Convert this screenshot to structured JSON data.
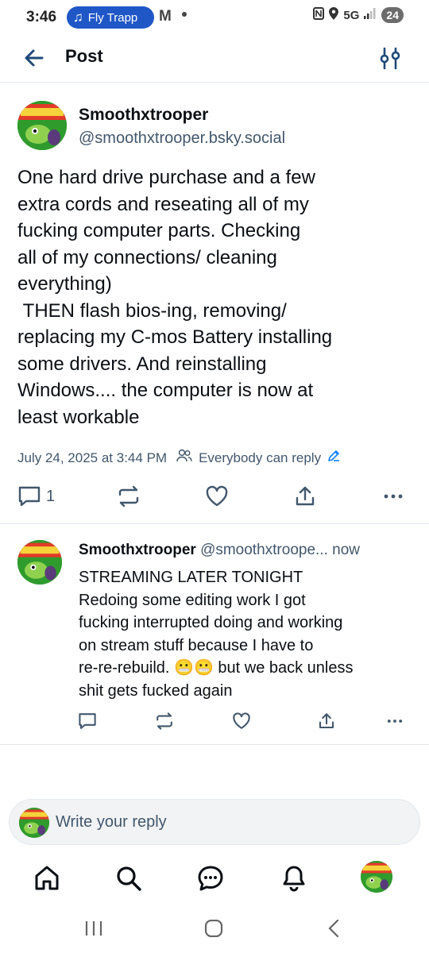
{
  "status_bar": {
    "time": "3:46",
    "music_pill": "Fly Trapp",
    "network": "5G",
    "battery": "24"
  },
  "header": {
    "title": "Post"
  },
  "post": {
    "author_name": "Smoothxtrooper",
    "author_handle": "@smoothxtrooper.bsky.social",
    "body": "One hard drive purchase and a few\nextra cords and reseating all of my\nfucking computer parts. Checking\nall of my connections/ cleaning\neverything)\n THEN flash bios-ing, removing/\nreplacing my C-mos Battery installing\nsome drivers. And reinstalling\nWindows.... the computer is now at\nleast workable",
    "timestamp": "July 24, 2025 at 3:44 PM",
    "reply_setting": "Everybody can reply",
    "reply_count": "1"
  },
  "reply": {
    "author_name": "Smoothxtrooper",
    "author_handle": "@smoothxtroope...",
    "age": "now",
    "body": "STREAMING LATER TONIGHT\nRedoing some editing work I got\nfucking interrupted doing and working\non stream stuff because I have to\nre-re-rebuild. 😬😬 but we back unless\nshit gets fucked again"
  },
  "composer": {
    "placeholder": "Write your reply"
  },
  "colors": {
    "accent": "#1083fe",
    "muted_text": "#42576c",
    "divider": "#e3e8ee",
    "pill_blue": "#1f57c7"
  },
  "icons": {
    "header": [
      "back-arrow-icon",
      "filter-icon"
    ],
    "actions": [
      "reply-icon",
      "repost-icon",
      "like-icon",
      "share-icon",
      "more-icon"
    ],
    "tabs": [
      "home-icon",
      "search-icon",
      "chat-icon",
      "notifications-icon",
      "profile-avatar"
    ]
  }
}
